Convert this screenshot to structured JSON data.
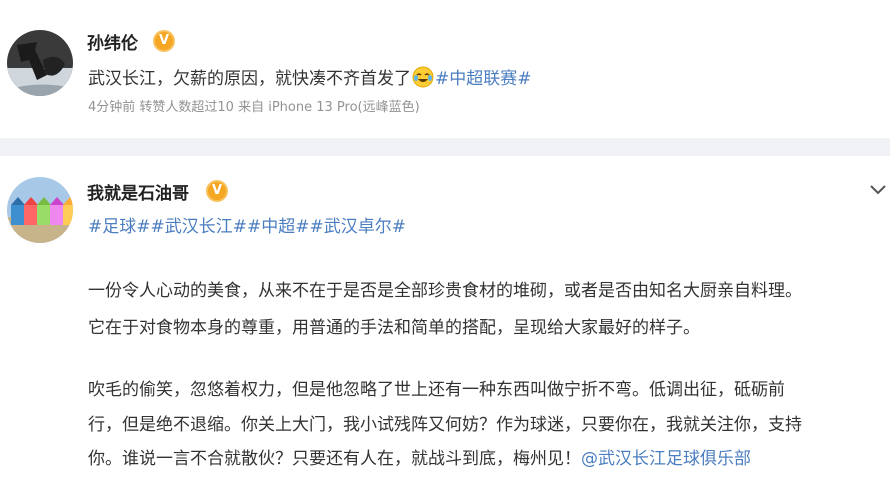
{
  "post1": {
    "author": "孙纬伦",
    "text": "武汉长江，欠薪的原因，就快凑不齐首发了",
    "hashtag": "#中超联赛#",
    "meta": "4分钟前 转赞人数超过10  来自 iPhone 13 Pro(远峰蓝色)"
  },
  "post2": {
    "author": "我就是石油哥",
    "hashtags": "#足球##武汉长江##中超##武汉卓尔#",
    "para1_line1": "一份令人心动的美食，从来不在于是否是全部珍贵食材的堆砌，或者是否由知名大厨亲自料理。",
    "para1_line2": "它在于对食物本身的尊重，用普通的手法和简单的搭配，呈现给大家最好的样子。",
    "para2_line1": "吹毛的偷笑，忽悠着权力，但是他忽略了世上还有一种东西叫做宁折不弯。低调出征，砥砺前",
    "para2_line2": "行，但是绝不退缩。你关上大门，我小试残阵又何妨？作为球迷，只要你在，我就关注你，支持",
    "para2_line3": "你。谁说一言不合就散伙？只要还有人在，就战斗到底，梅州见！",
    "mention": "@武汉长江足球俱乐部"
  },
  "colors": {
    "link": "#4b7ec0",
    "meta": "#939393",
    "badge": "#f5a623",
    "separator": "#f1f2f5"
  },
  "icons": [
    "verified-badge-icon",
    "laugh-cry-emoji-icon",
    "chevron-down-icon"
  ]
}
